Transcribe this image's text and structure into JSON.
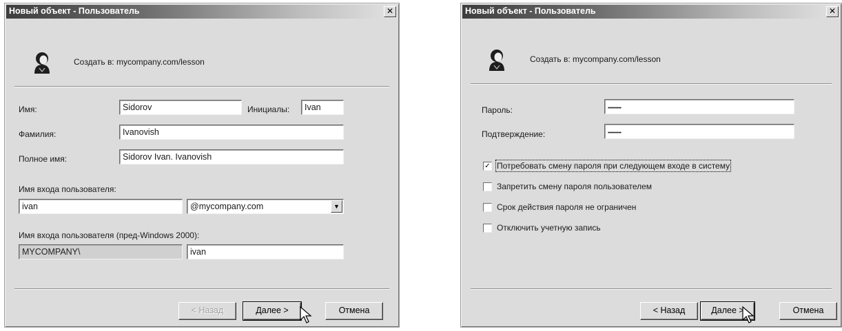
{
  "dialog1": {
    "title": "Новый объект - Пользователь",
    "close_label": "✕",
    "create_in_label": "Создать в:",
    "create_in_value": "mycompany.com/lesson",
    "first_name_label": "Имя:",
    "first_name_value": "Sidorov",
    "initials_label": "Инициалы:",
    "initials_value": "Ivan",
    "last_name_label": "Фамилия:",
    "last_name_value": "Ivanovish",
    "full_name_label": "Полное имя:",
    "full_name_value": "Sidorov Ivan. Ivanovish",
    "logon_label": "Имя входа пользователя:",
    "logon_value": "ivan",
    "domain_value": "@mycompany.com",
    "pre2000_label": "Имя входа пользователя (пред-Windows 2000):",
    "pre2000_domain_value": "MYCOMPANY\\",
    "pre2000_name_value": "ivan",
    "back_label": "< Назад",
    "next_label": "Далее >",
    "cancel_label": "Отмена"
  },
  "dialog2": {
    "title": "Новый объект - Пользователь",
    "close_label": "✕",
    "create_in_label": "Создать в:",
    "create_in_value": "mycompany.com/lesson",
    "password_label": "Пароль:",
    "password_value": "••••••••••",
    "confirm_label": "Подтверждение:",
    "confirm_value": "••••••••••",
    "checkboxes": [
      {
        "label": "Потребовать смену пароля при следующем входе в систему",
        "checked": true,
        "mark": "✓"
      },
      {
        "label": "Запретить смену пароля пользователем",
        "checked": false,
        "mark": ""
      },
      {
        "label": "Срок действия пароля не ограничен",
        "checked": false,
        "mark": ""
      },
      {
        "label": "Отключить учетную запись",
        "checked": false,
        "mark": ""
      }
    ],
    "back_label": "< Назад",
    "next_label": "Далее >",
    "cancel_label": "Отмена"
  },
  "icons": {
    "user": "user-icon",
    "cursor": "mouse-pointer-icon",
    "dropdown": "chevron-down-icon",
    "close": "close-icon"
  }
}
